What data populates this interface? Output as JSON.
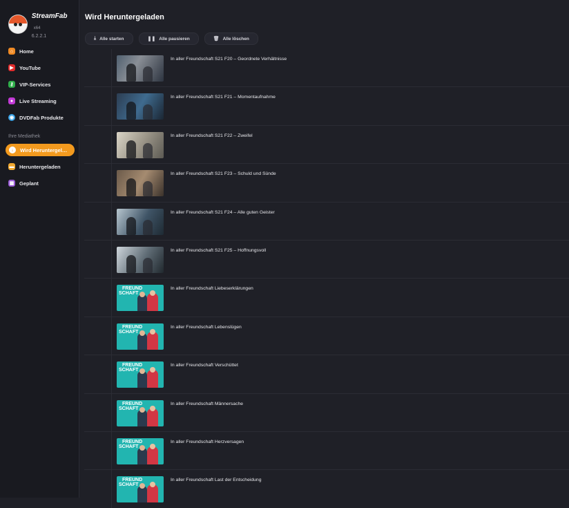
{
  "app": {
    "name": "StreamFab",
    "arch": "x64",
    "version": "6.2.2.1"
  },
  "sidebar": {
    "items": [
      {
        "label": "Home",
        "icon": "home-icon",
        "color": "#f08a24"
      },
      {
        "label": "YouTube",
        "icon": "youtube-icon",
        "color": "#e02b2b"
      },
      {
        "label": "VIP-Services",
        "icon": "key-icon",
        "color": "#2fae4a"
      },
      {
        "label": "Live Streaming",
        "icon": "live-icon",
        "color": "#c23ad6"
      },
      {
        "label": "DVDFab Produkte",
        "icon": "dvdfab-icon",
        "color": "#3aa4e8"
      }
    ],
    "section_label": "Ihre Mediathek",
    "library": [
      {
        "label": "Wird Heruntergela…",
        "icon": "download-icon",
        "active": true
      },
      {
        "label": "Heruntergeladen",
        "icon": "folder-icon",
        "color": "#f0a830"
      },
      {
        "label": "Geplant",
        "icon": "calendar-icon",
        "color": "#9a5bd6"
      }
    ]
  },
  "main": {
    "title": "Wird Heruntergeladen",
    "toolbar": {
      "start_all": "Alle starten",
      "pause_all": "Alle pausieren",
      "delete_all": "Alle löschen"
    },
    "items": [
      {
        "title": "In aller Freundschaft S21 F20 – Geordnete Verhältnisse",
        "thumb": "photo"
      },
      {
        "title": "In aller Freundschaft S21 F21 – Momentaufnahme",
        "thumb": "photo"
      },
      {
        "title": "In aller Freundschaft S21 F22 – Zweifel",
        "thumb": "photo"
      },
      {
        "title": "In aller Freundschaft S21 F23 – Schuld und Sünde",
        "thumb": "photo"
      },
      {
        "title": "In aller Freundschaft S21 F24 – Alle guten Geister",
        "thumb": "photo"
      },
      {
        "title": "In aller Freundschaft S21 F25 – Hoffnungsvoll",
        "thumb": "photo"
      },
      {
        "title": "In aller Freundschaft Liebeserklärungen",
        "thumb": "poster"
      },
      {
        "title": "In aller Freundschaft Lebenslügen",
        "thumb": "poster"
      },
      {
        "title": "In aller Freundschaft Verschüttet",
        "thumb": "poster"
      },
      {
        "title": "In aller Freundschaft Männersache",
        "thumb": "poster"
      },
      {
        "title": "In aller Freundschaft Herzversagen",
        "thumb": "poster"
      },
      {
        "title": "In aller Freundschaft Last der Entscheidung",
        "thumb": "poster"
      }
    ],
    "poster_text": {
      "line1": "FREUND",
      "line2": "SCHAFT"
    }
  },
  "colors": {
    "accent": "#f39a1e",
    "background": "#1f2027",
    "sidebar": "#191a20",
    "poster": "#22b5b0"
  }
}
